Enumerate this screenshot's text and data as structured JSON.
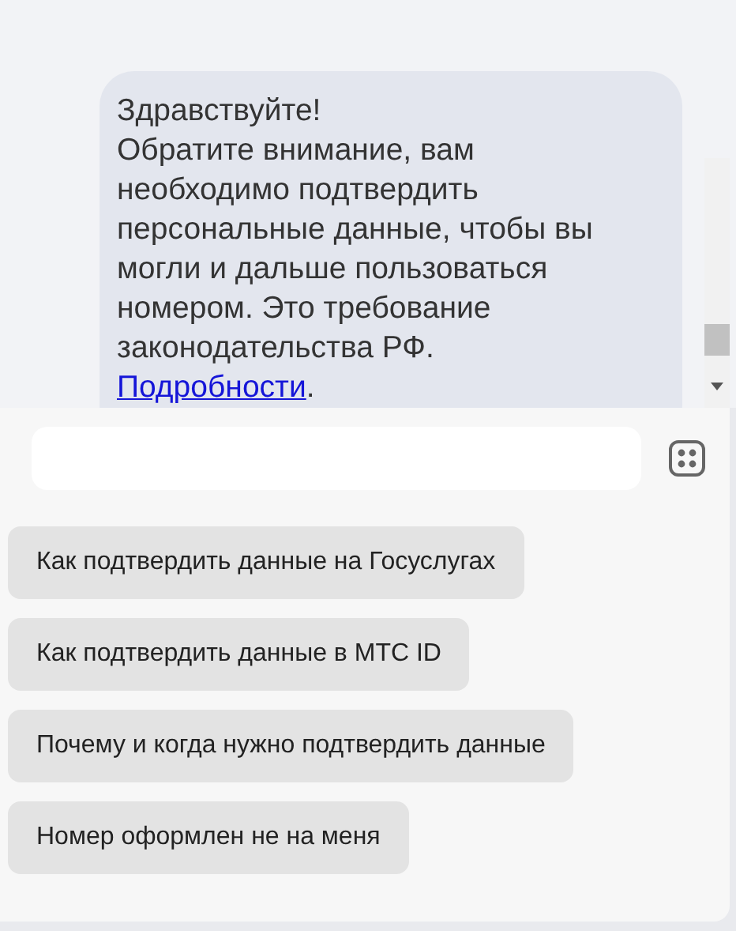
{
  "message": {
    "greeting": "Здравствуйте!",
    "text": "Обратите внимание, вам необходимо подтвердить персональные данные, чтобы вы могли и дальше пользоваться номером. Это требование законодательства РФ.",
    "link": "Подробности",
    "after_link": "."
  },
  "suggestions": [
    {
      "label": "Как подтвердить данные на Госуслугах"
    },
    {
      "label": "Как подтвердить данные в МТС ID"
    },
    {
      "label": "Почему и когда нужно подтвердить данные"
    },
    {
      "label": "Номер оформлен не на меня"
    }
  ]
}
